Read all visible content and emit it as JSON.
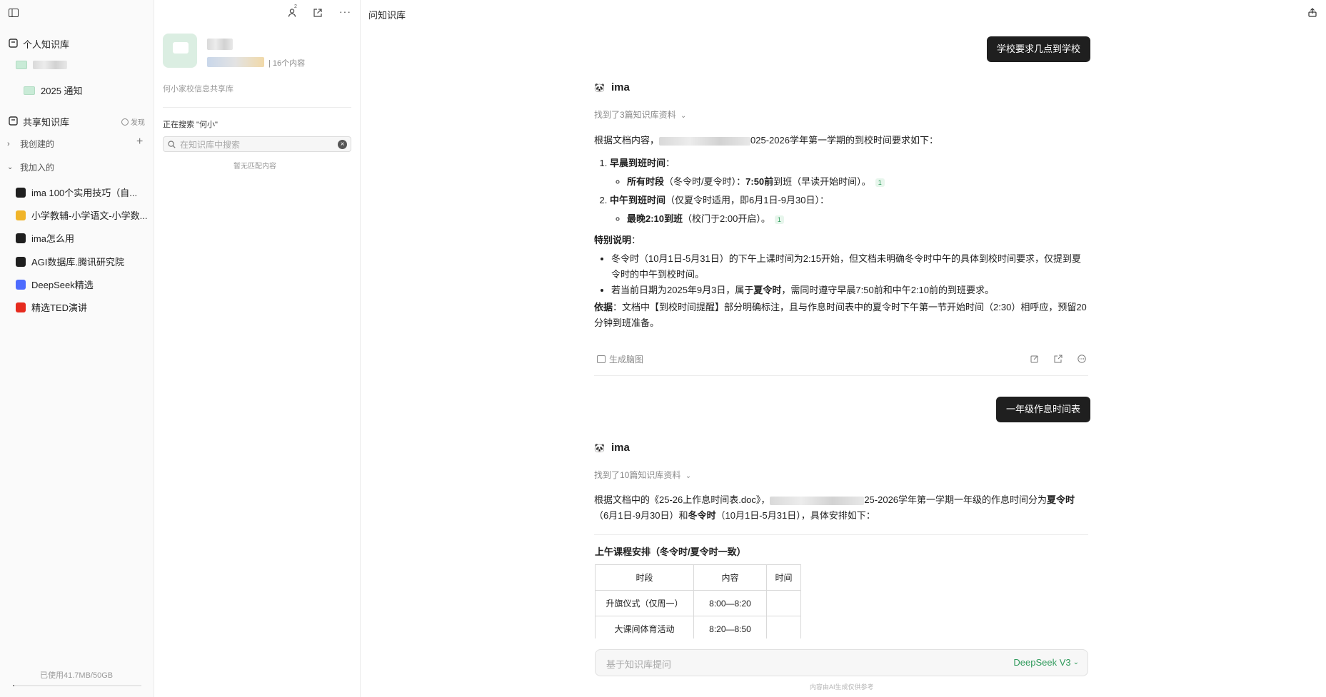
{
  "sidebar": {
    "personal_kb": "个人知识库",
    "personal_folder_2025": "2025 通知",
    "shared_kb": "共享知识库",
    "discover": "发现",
    "created_by_me": "我创建的",
    "joined": "我加入的",
    "joined_items": [
      {
        "label": "ima  100个实用技巧（自...",
        "icon": "panda-icon",
        "color": "#1f1f1f"
      },
      {
        "label": "小学教辅-小学语文-小学数...",
        "icon": "book-icon",
        "color": "#f0b429"
      },
      {
        "label": "ima怎么用",
        "icon": "panda-icon",
        "color": "#1f1f1f"
      },
      {
        "label": "AGI数据库.腾讯研究院",
        "icon": "agi-icon",
        "color": "#1f1f1f"
      },
      {
        "label": "DeepSeek精选",
        "icon": "deepseek-icon",
        "color": "#4d6bfe"
      },
      {
        "label": "精选TED演讲",
        "icon": "ted-icon",
        "color": "#e62b1e"
      }
    ],
    "storage": "已使用41.7MB/50GB"
  },
  "kb_panel": {
    "count": "| 16个内容",
    "desc": "何小家校信息共享库",
    "searching_label": "正在搜索 \"何小\"",
    "search_placeholder": "在知识库中搜索",
    "no_match": "暂无匹配内容",
    "members_badge": "2"
  },
  "chat": {
    "title": "问知识库",
    "q1": "学校要求几点到学校",
    "bot_name": "ima",
    "found1": "找到了3篇知识库资料",
    "a1_intro_suffix": "025-2026学年第一学期的到校时间要求如下：",
    "a1_item1_title": "早晨到班时间",
    "a1_item1_colon": "：",
    "a1_item1_sub_bold": "所有时段",
    "a1_item1_sub_mid": "（冬令时/夏令时）：",
    "a1_item1_sub_time": "7:50前",
    "a1_item1_sub_end": "到班（早读开始时间）。",
    "a1_item2_title": "中午到班时间",
    "a1_item2_rest": "（仅夏令时适用，即6月1日-9月30日）：",
    "a1_item2_sub_bold": "最晚2:10到班",
    "a1_item2_sub_end": "（校门于2:00开启）。",
    "cite_num": "1",
    "special_title": "特别说明",
    "special_colon": "：",
    "special_1": "冬令时（10月1日-5月31日）的下午上课时间为2:15开始，但文档未明确冬令时中午的具体到校时间要求，仅提到夏令时的中午到校时间。",
    "special_2_a": "若当前日期为2025年9月3日，属于",
    "special_2_bold": "夏令时",
    "special_2_b": "，需同时遵守早晨7:50前和中午2:10前的到班要求。",
    "basis_bold": "依据",
    "basis_text": "：文档中【到校时间提醒】部分明确标注，且与作息时间表中的夏令时下午第一节开始时间（2:30）相呼应，预留20分钟到班准备。",
    "mindmap": "生成脑图",
    "q2": "一年级作息时间表",
    "found2": "找到了10篇知识库资料",
    "a2_a": "根据文档中的《25-26上作息时间表.doc》，",
    "a2_b": "25-2026学年第一学期一年级的作息时间分为",
    "a2_summer": "夏令时",
    "a2_c": "（6月1日-9月30日）和",
    "a2_winter": "冬令时",
    "a2_d": "（10月1日-5月31日），具体安排如下：",
    "a1_intro_prefix": "根据文档内容，",
    "table_title": "上午课程安排（冬令时/夏令时一致）",
    "table_headers": [
      "时段",
      "内容",
      "时间"
    ],
    "table_rows": [
      [
        "升旗仪式（仅周一）",
        "8:00—8:20",
        ""
      ],
      [
        "大课间体育活动",
        "8:20—8:50",
        ""
      ]
    ],
    "input_placeholder": "基于知识库提问",
    "model": "DeepSeek V3",
    "disclaimer": "内容由AI生成仅供参考"
  },
  "colors": {
    "accent": "#2f9a5b",
    "bubble": "#1f1f1f",
    "folder": "#c9ebd7"
  }
}
